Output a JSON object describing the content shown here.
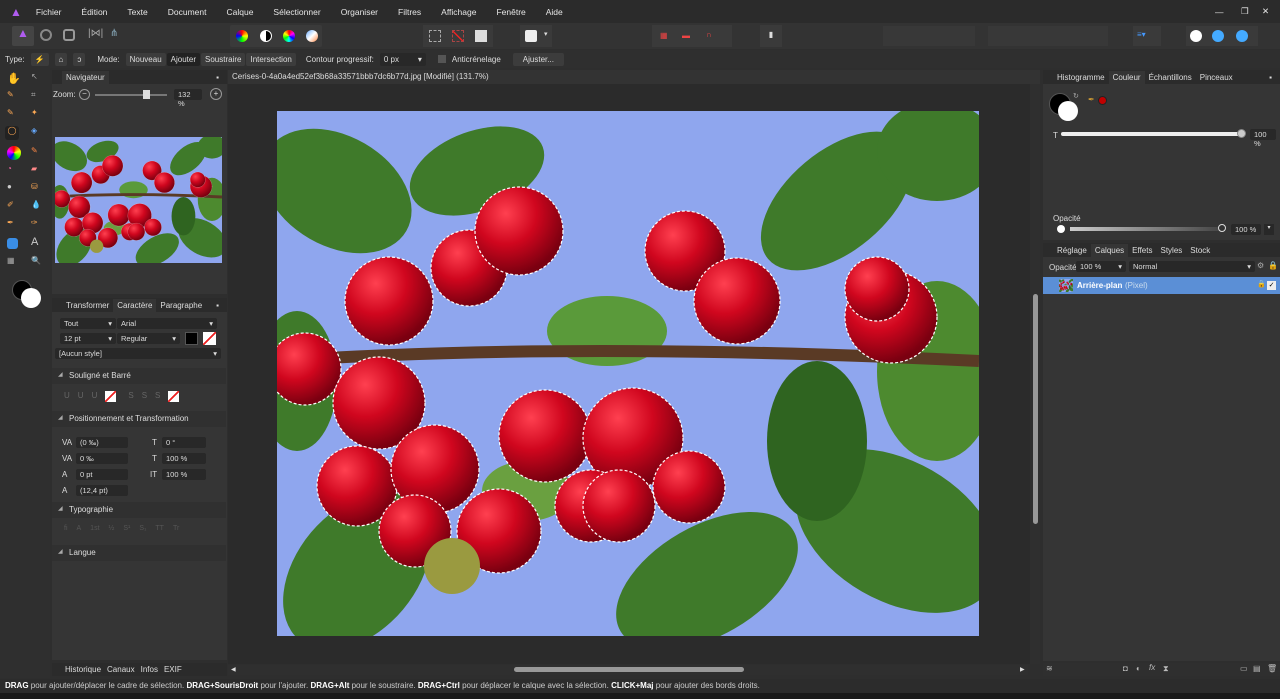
{
  "menu": [
    "Fichier",
    "Édition",
    "Texte",
    "Document",
    "Calque",
    "Sélectionner",
    "Organiser",
    "Filtres",
    "Affichage",
    "Fenêtre",
    "Aide"
  ],
  "context": {
    "type_label": "Type:",
    "mode_label": "Mode:",
    "modes": [
      "Nouveau",
      "Ajouter",
      "Soustraire",
      "Intersection"
    ],
    "selected_mode": "Ajouter",
    "feather_label": "Contour progressif:",
    "feather_value": "0 px",
    "antialias_label": "Anticrénelage",
    "adjust_button": "Ajuster..."
  },
  "navigator": {
    "tab": "Navigateur",
    "zoom_label": "Zoom:",
    "zoom_value": "132 %",
    "zoom_fraction": 0.66
  },
  "character": {
    "tabs": [
      "Transformer",
      "Caractère",
      "Paragraphe"
    ],
    "active": "Caractère",
    "scope": "Tout",
    "font": "Arial",
    "size": "12 pt",
    "weight": "Regular",
    "style": "[Aucun style]",
    "sections": {
      "underline": "Souligné et Barré",
      "position": "Positionnement et Transformation",
      "typography": "Typographie",
      "language": "Langue"
    },
    "underline_glyphs": [
      "U",
      "U",
      "U"
    ],
    "strike_glyphs": [
      "S",
      "S",
      "S"
    ],
    "fields": {
      "kerning": "(0 ‰)",
      "tracking": "0 ‰",
      "baseline": "0 pt",
      "leading": "(12,4 pt)",
      "skew": "0 °",
      "vscale": "100 %",
      "hscale": "100 %"
    },
    "typo_glyphs": [
      "fi",
      "A",
      "1st",
      "½",
      "S¹",
      "S₁",
      "TT",
      "Tr"
    ]
  },
  "bottom_tabs": [
    "Historique",
    "Canaux",
    "Infos",
    "EXIF"
  ],
  "document": {
    "title": "Cerises-0-4a0a4ed52ef3b68a33571bbb7dc6b77d.jpg [Modifié] (131.7%)"
  },
  "color_panel": {
    "tabs": [
      "Histogramme",
      "Couleur",
      "Échantillons",
      "Pinceaux"
    ],
    "active": "Couleur",
    "t_label": "T",
    "t_value": "100 %",
    "opacity_label": "Opacité",
    "opacity_value": "100 %",
    "swatch_color": "#c00000"
  },
  "layers": {
    "tabs": [
      "Réglage",
      "Calques",
      "Effets",
      "Styles",
      "Stock"
    ],
    "active": "Calques",
    "opacity_label": "Opacité:",
    "opacity_value": "100 %",
    "blend": "Normal",
    "layer_name": "Arrière-plan",
    "layer_type": "(Pixel)"
  },
  "status": [
    {
      "b": "DRAG",
      "t": " pour ajouter/déplacer le cadre de sélection. "
    },
    {
      "b": "DRAG+SourisDroit",
      "t": " pour l'ajouter. "
    },
    {
      "b": "DRAG+Alt",
      "t": " pour le soustraire. "
    },
    {
      "b": "DRAG+Ctrl",
      "t": " pour déplacer le calque avec la sélection. "
    },
    {
      "b": "CLICK+Maj",
      "t": " pour ajouter des bords droits."
    }
  ]
}
